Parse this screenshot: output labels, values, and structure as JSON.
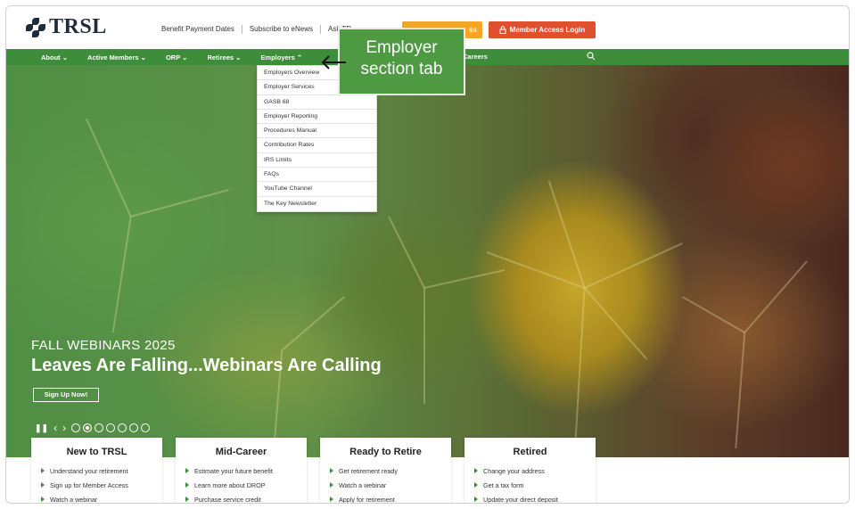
{
  "logo": {
    "text": "TRSL"
  },
  "top_links": [
    "Benefit Payment Dates",
    "Subscribe to eNews",
    "Ask TR"
  ],
  "buttons": {
    "orange_label": "ss",
    "login_label": "Member Access Login"
  },
  "nav": {
    "items": [
      "About ⌄",
      "Active Members ⌄",
      "ORP ⌄",
      "Retirees ⌄",
      "Employers ⌃"
    ],
    "careers": "Careers"
  },
  "dropdown": {
    "items": [
      "Employers Overview",
      "Employer Services",
      "GASB 68",
      "Employer Reporting",
      "Procedures Manual",
      "Contribution Rates",
      "IRS Limits",
      "FAQs",
      "YouTube Channel",
      "The Key Newsletter"
    ]
  },
  "annotation": {
    "line1": "Employer",
    "line2": "section tab"
  },
  "hero": {
    "kicker": "FALL WEBINARS 2025",
    "title": "Leaves Are Falling...Webinars Are Calling",
    "button": "Sign Up Now!",
    "slides_total": 7,
    "slide_active": 2
  },
  "cards": [
    {
      "title": "New to TRSL",
      "links": [
        "Understand your retirement",
        "Sign up for Member Access",
        "Watch a webinar"
      ]
    },
    {
      "title": "Mid-Career",
      "links": [
        "Estimate your future benefit",
        "Learn more about DROP",
        "Purchase service credit"
      ]
    },
    {
      "title": "Ready to Retire",
      "links": [
        "Get retirement ready",
        "Watch a webinar",
        "Apply for retirement"
      ]
    },
    {
      "title": "Retired",
      "links": [
        "Change your address",
        "Get a tax form",
        "Update your direct deposit"
      ]
    }
  ],
  "colors": {
    "nav_green": "#3e8d3a",
    "login_red": "#e0502e",
    "orange": "#f5a623"
  }
}
